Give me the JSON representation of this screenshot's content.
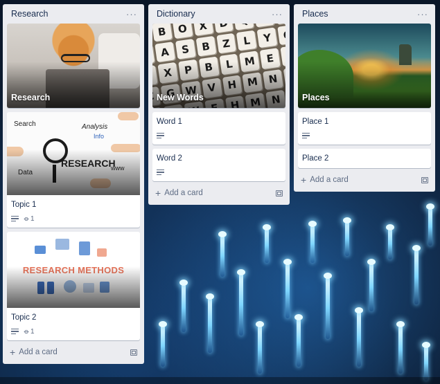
{
  "lists": [
    {
      "title": "Research",
      "menu_label": "···",
      "cards": [
        {
          "cover_title": "Research"
        },
        {
          "title": "Topic 1",
          "attachments": "1"
        },
        {
          "title": "Topic 2",
          "attachments": "1"
        }
      ],
      "add_label": "Add a card"
    },
    {
      "title": "Dictionary",
      "menu_label": "···",
      "cards": [
        {
          "cover_title": "New Words"
        },
        {
          "title": "Word 1"
        },
        {
          "title": "Word 2"
        }
      ],
      "add_label": "Add a card"
    },
    {
      "title": "Places",
      "menu_label": "···",
      "cards": [
        {
          "cover_title": "Places"
        },
        {
          "title": "Place 1"
        },
        {
          "title": "Place 2"
        }
      ],
      "add_label": "Add a card"
    }
  ],
  "cover_art_text": {
    "topic1_words": [
      "Search",
      "Analysis",
      "Info",
      "RESEARCH",
      "Data",
      "www"
    ],
    "topic2_banner": "RESEARCH METHODS",
    "dictionary_letters": [
      "Y",
      "B",
      "O",
      "X",
      "D",
      "Q",
      "B",
      "A",
      "V",
      "A",
      "S",
      "B",
      "Z",
      "L",
      "Y",
      "Q",
      "B",
      "X",
      "P",
      "B",
      "L",
      "M",
      "E",
      "C",
      "C",
      "G",
      "W",
      "V",
      "H",
      "M",
      "N",
      "C",
      "X",
      "R",
      "W",
      "E",
      "H",
      "M",
      "N",
      "Q"
    ]
  },
  "colors": {
    "list_bg": "#ebecf0",
    "card_bg": "#ffffff",
    "text": "#172b4d",
    "muted": "#5e6c84",
    "banner_accent": "#e8745a"
  },
  "icons": {
    "list_menu": "ellipsis-icon",
    "description": "description-lines-icon",
    "attachment": "paperclip-icon",
    "add": "plus-icon",
    "template": "card-template-icon"
  }
}
